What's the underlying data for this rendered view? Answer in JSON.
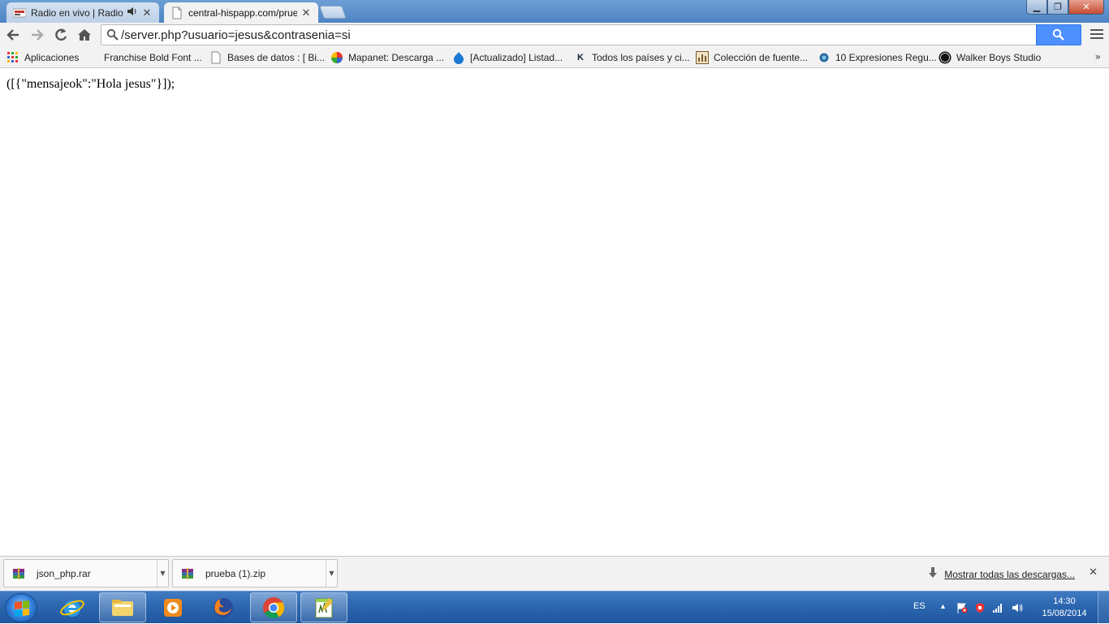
{
  "tabs": [
    {
      "title": "Radio en vivo | Radio en",
      "active": false,
      "has_audio": true
    },
    {
      "title": "central-hispapp.com/prue",
      "active": true,
      "has_audio": false
    }
  ],
  "omnibox": {
    "url": "/server.php?usuario=jesus&contrasenia=si"
  },
  "bookmarks": [
    {
      "label": "Aplicaciones",
      "icon": "apps-grid-icon"
    },
    {
      "label": "Franchise Bold Font ...",
      "icon": "none"
    },
    {
      "label": "Bases de datos : [ Bi...",
      "icon": "page-icon"
    },
    {
      "label": "Mapanet: Descarga ...",
      "icon": "mapanet-icon"
    },
    {
      "label": "[Actualizado] Listad...",
      "icon": "drupal-icon"
    },
    {
      "label": "Todos los países y ci...",
      "icon": "k-icon"
    },
    {
      "label": "Colección de fuente...",
      "icon": "chart-icon"
    },
    {
      "label": "10 Expresiones Regu...",
      "icon": "globe-icon"
    },
    {
      "label": "Walker Boys Studio",
      "icon": "wbs-icon"
    }
  ],
  "page": {
    "body_text": "([{\"mensajeok\":\"Hola jesus\"}]);"
  },
  "downloads": [
    {
      "filename": "json_php.rar"
    },
    {
      "filename": "prueba (1).zip"
    }
  ],
  "download_shelf": {
    "show_all_label": "Mostrar todas las descargas..."
  },
  "taskbar": {
    "apps": [
      "internet-explorer-icon",
      "file-explorer-icon",
      "media-player-icon",
      "firefox-icon",
      "chrome-icon",
      "notepad-plus-icon"
    ],
    "language": "ES",
    "time": "14:30",
    "date": "15/08/2014"
  }
}
